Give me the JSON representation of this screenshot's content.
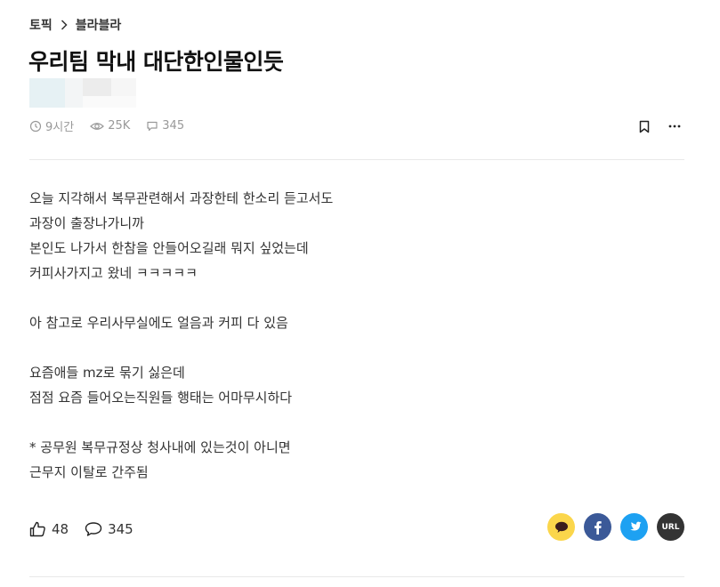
{
  "breadcrumb": {
    "root": "토픽",
    "current": "블라블라"
  },
  "post": {
    "title": "우리팀 막내 대단한인물인듯",
    "meta": {
      "time": "9시간",
      "views": "25K",
      "comments": "345"
    }
  },
  "content": {
    "lines": [
      "오늘 지각해서 복무관련해서 과장한테 한소리 듣고서도",
      "과장이 출장나가니까",
      "본인도 나가서 한참을 안들어오길래 뭐지 싶었는데",
      "커피사가지고 왔네 ㅋㅋㅋㅋㅋ",
      "",
      "아 참고로 우리사무실에도 얼음과 커피 다 있음",
      "",
      "요즘애들 mz로 묶기 싫은데",
      "점점 요즘 들어오는직원들 행태는 어마무시하다",
      "",
      "* 공무원 복무규정상 청사내에 있는것이 아니면",
      "근무지 이탈로 간주됨"
    ]
  },
  "reactions": {
    "likes": "48",
    "comments": "345"
  },
  "share": {
    "url_label": "URL"
  },
  "colors": {
    "kakao": "#fbd64b",
    "facebook": "#3b5998",
    "twitter": "#1da1f2",
    "url": "#333333"
  },
  "icons": [
    "chevron-right-icon",
    "clock-icon",
    "eye-icon",
    "comment-icon",
    "bookmark-icon",
    "more-icon",
    "thumbs-up-icon",
    "kakao-icon",
    "facebook-icon",
    "twitter-icon"
  ]
}
